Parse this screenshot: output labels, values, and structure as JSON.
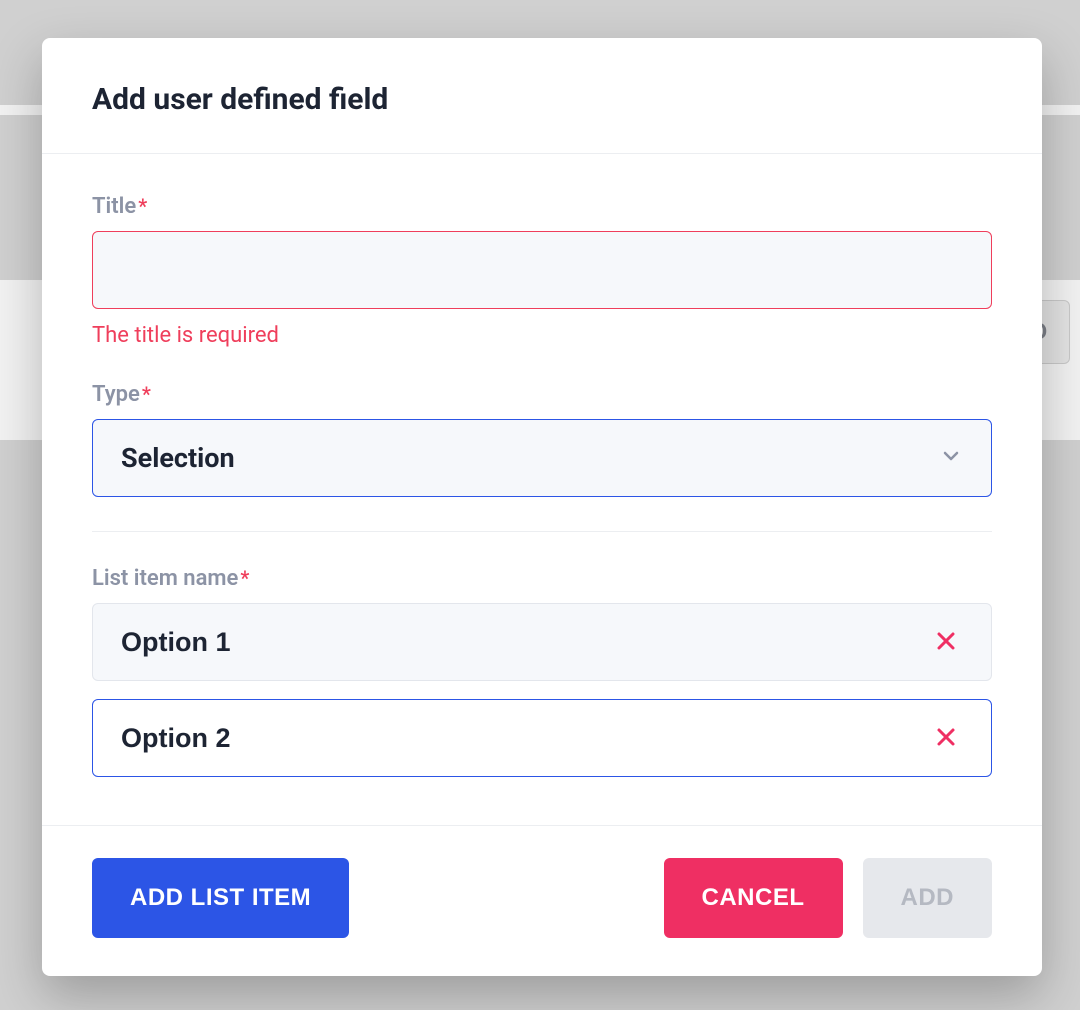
{
  "background": {
    "partial_button_text": "D"
  },
  "modal": {
    "title": "Add user defined field",
    "fields": {
      "title": {
        "label": "Title",
        "required": true,
        "value": "",
        "error": "The title is required"
      },
      "type": {
        "label": "Type",
        "required": true,
        "selected": "Selection"
      },
      "list_item_name": {
        "label": "List item name",
        "required": true,
        "items": [
          {
            "name": "Option 1",
            "focused": false
          },
          {
            "name": "Option 2",
            "focused": true
          }
        ]
      }
    },
    "buttons": {
      "add_list_item": "ADD LIST ITEM",
      "cancel": "CANCEL",
      "add": "ADD",
      "add_disabled": true
    }
  }
}
